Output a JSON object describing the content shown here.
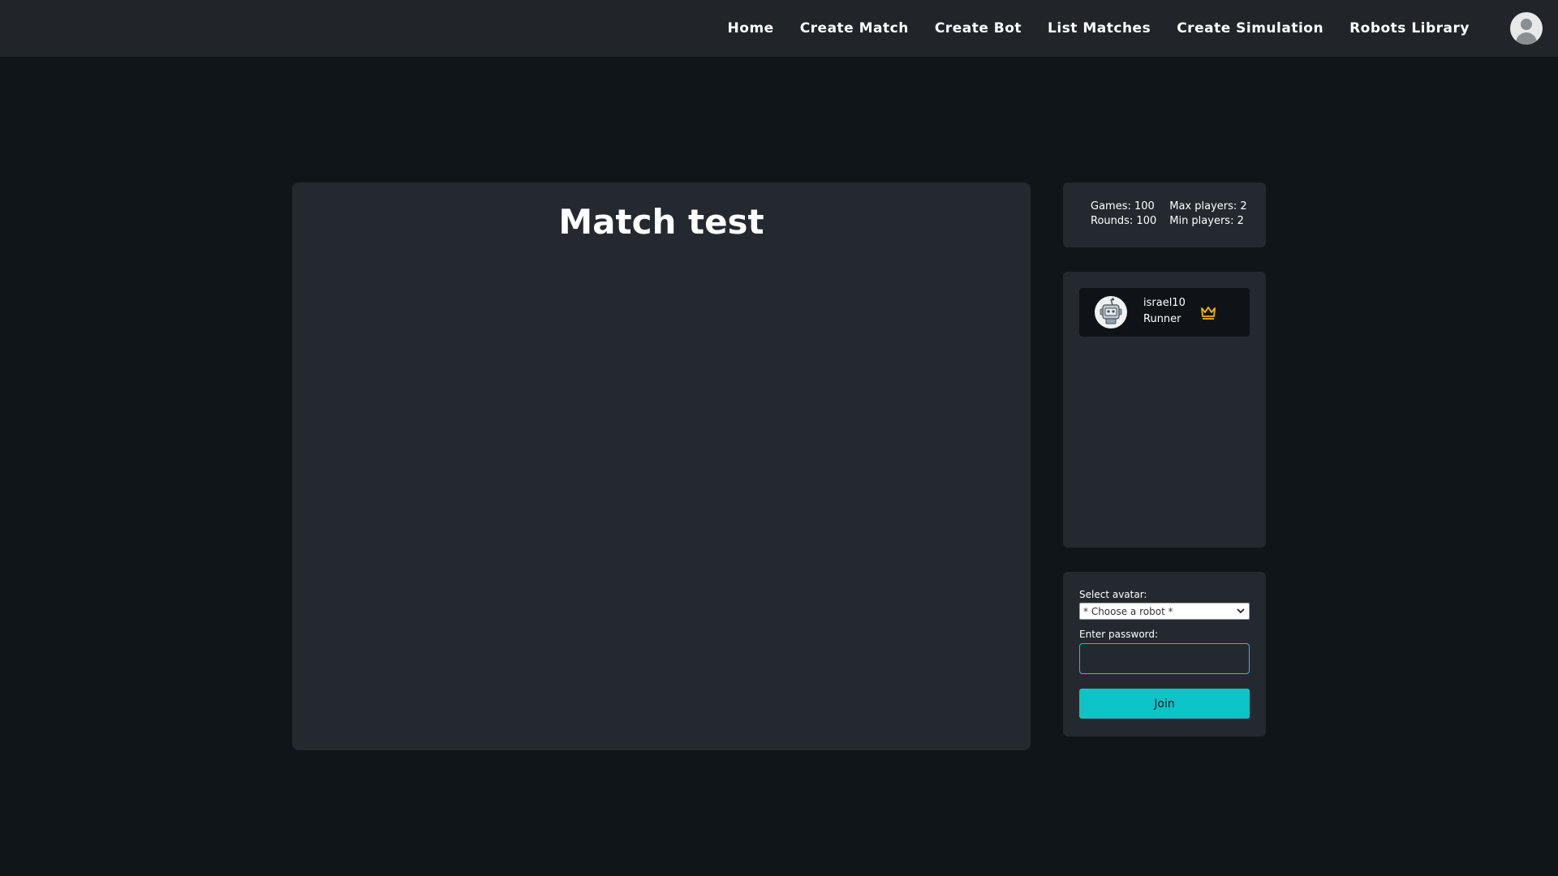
{
  "nav": {
    "links": [
      "Home",
      "Create Match",
      "Create Bot",
      "List Matches",
      "Create Simulation",
      "Robots Library"
    ]
  },
  "match": {
    "title": "Match test"
  },
  "stats": {
    "games": "Games: 100",
    "max_players": "Max players: 2",
    "rounds": "Rounds: 100",
    "min_players": "Min players: 2"
  },
  "players": [
    {
      "name": "israel10",
      "role": "Runner",
      "icon": "crown-icon"
    }
  ],
  "join_form": {
    "avatar_label": "Select avatar:",
    "avatar_selected": "* Choose a robot *",
    "password_label": "Enter password:",
    "password_value": "",
    "join_label": "Join"
  },
  "colors": {
    "background": "#10151a",
    "navbar": "#212529",
    "card": "#24292f",
    "accent": "#0cc4c8",
    "crown": "#f5b800"
  }
}
